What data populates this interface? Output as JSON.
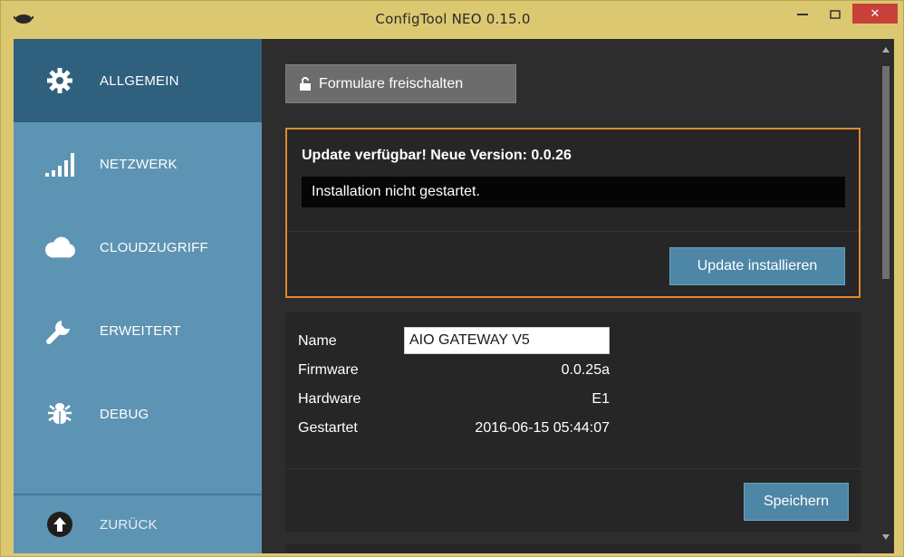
{
  "window": {
    "title": "ConfigTool NEO 0.15.0",
    "close_symbol": "✕"
  },
  "sidebar": {
    "items": [
      {
        "label": "ALLGEMEIN",
        "icon": "gear-icon",
        "active": true
      },
      {
        "label": "NETZWERK",
        "icon": "signal-bars-icon",
        "active": false
      },
      {
        "label": "CLOUDZUGRIFF",
        "icon": "cloud-icon",
        "active": false
      },
      {
        "label": "ERWEITERT",
        "icon": "wrench-icon",
        "active": false
      },
      {
        "label": "DEBUG",
        "icon": "bug-icon",
        "active": false
      }
    ],
    "back": {
      "label": "ZURÜCK",
      "icon": "arrow-up-circle-icon"
    }
  },
  "main": {
    "unlock_button": "Formulare freischalten",
    "update": {
      "heading": "Update verfügbar! Neue Version: 0.0.26",
      "status": "Installation nicht gestartet.",
      "install_button": "Update installieren"
    },
    "device": {
      "name_label": "Name",
      "name_value": "AIO GATEWAY V5",
      "firmware_label": "Firmware",
      "firmware_value": "0.0.25a",
      "hardware_label": "Hardware",
      "hardware_value": "E1",
      "started_label": "Gestartet",
      "started_value": "2016-06-15 05:44:07",
      "save_button": "Speichern"
    }
  },
  "colors": {
    "accent_active": "#2f607e",
    "sidebar": "#5d94b3",
    "update_border": "#e0882f",
    "button": "#4e86a6"
  }
}
